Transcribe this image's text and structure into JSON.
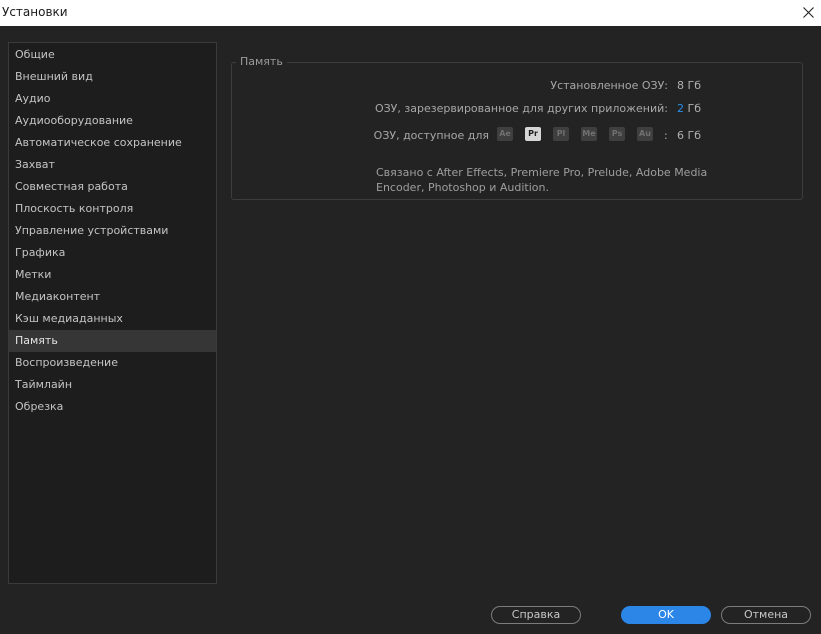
{
  "window": {
    "title": "Установки"
  },
  "sidebar": {
    "items": [
      {
        "label": "Общие"
      },
      {
        "label": "Внешний вид"
      },
      {
        "label": "Аудио"
      },
      {
        "label": "Аудиооборудование"
      },
      {
        "label": "Автоматическое сохранение"
      },
      {
        "label": "Захват"
      },
      {
        "label": "Совместная работа"
      },
      {
        "label": "Плоскость контроля"
      },
      {
        "label": "Управление устройствами"
      },
      {
        "label": "Графика"
      },
      {
        "label": "Метки"
      },
      {
        "label": "Медиаконтент"
      },
      {
        "label": "Кэш медиаданных"
      },
      {
        "label": "Память"
      },
      {
        "label": "Воспроизведение"
      },
      {
        "label": "Таймлайн"
      },
      {
        "label": "Обрезка"
      }
    ],
    "selected": "Память"
  },
  "memory": {
    "group_title": "Память",
    "installed_label": "Установленное ОЗУ:",
    "installed_value": "8 Гб",
    "reserved_label": "ОЗУ, зарезервированное для других приложений:",
    "reserved_number": "2",
    "reserved_unit": "Гб",
    "available_label": "ОЗУ, доступное для",
    "available_colon": ":",
    "available_value": "6 Гб",
    "apps": [
      {
        "abbr": "Ae",
        "active": false
      },
      {
        "abbr": "Pr",
        "active": true
      },
      {
        "abbr": "Pl",
        "active": false
      },
      {
        "abbr": "Me",
        "active": false
      },
      {
        "abbr": "Ps",
        "active": false
      },
      {
        "abbr": "Au",
        "active": false
      }
    ],
    "note": "Связано с After Effects, Premiere Pro, Prelude, Adobe Media Encoder, Photoshop и Audition."
  },
  "footer": {
    "help_label": "Справка",
    "ok_label": "OK",
    "cancel_label": "Отмена"
  },
  "colors": {
    "accent": "#2b86e7",
    "link": "#2b8eea",
    "background": "#232323"
  }
}
